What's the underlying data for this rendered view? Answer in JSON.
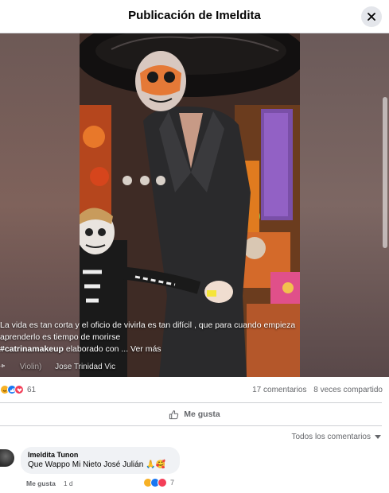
{
  "dialog": {
    "title": "Publicación de Imeldita",
    "close_icon": "close-icon"
  },
  "post": {
    "caption_line1": "La vida es tan corta y el oficio de vivirla es tan difícil , que para cuando empieza",
    "caption_line2": "aprenderlo es tiempo de morirse",
    "hashtag": "#catrinamakeup",
    "caption_tail": " elaborado con ... ",
    "see_more": "Ver más",
    "audio_icon": "audio-wave-icon",
    "audio_dim": "Violin)",
    "audio_artist": "Jose Trinidad Vic"
  },
  "stats": {
    "reaction_count": "61",
    "comments": "17 comentarios",
    "shares": "8 veces compartido",
    "reactions": [
      "haha",
      "like",
      "love"
    ]
  },
  "actions": {
    "like_label": "Me gusta"
  },
  "comments_section": {
    "sort_label": "Todos los comentarios"
  },
  "comment": {
    "author": "Imeldita Tunon",
    "text": "Que Wappo Mi Nieto José Julián 🙏🥰",
    "like_action": "Me gusta",
    "time": "1 d",
    "reaction_count": "7"
  },
  "colors": {
    "like_blue": "#1877f2",
    "love_red": "#f33e58",
    "haha_yellow": "#f7b125",
    "muted_text": "#65676b"
  }
}
